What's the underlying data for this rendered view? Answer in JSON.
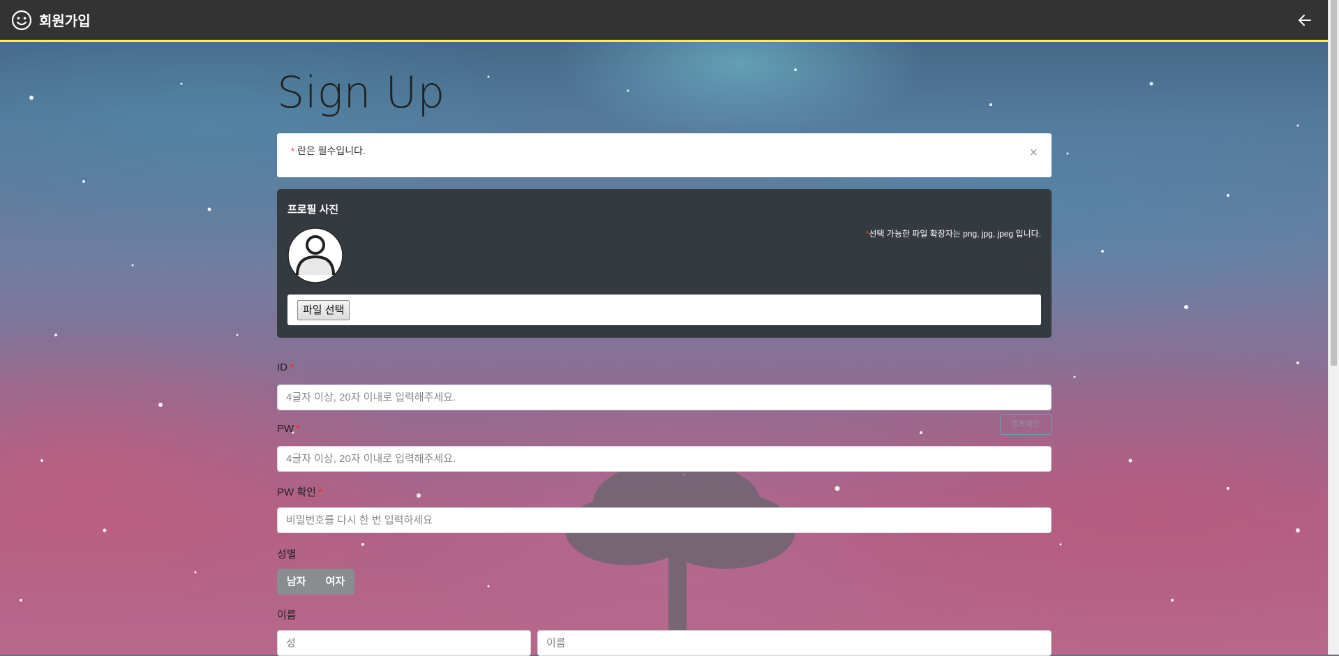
{
  "header": {
    "app_icon": "smile-icon",
    "title": "회원가입",
    "back_icon": "arrow-left-icon"
  },
  "page": {
    "title": "Sign Up"
  },
  "notice": {
    "required_mark": "*",
    "text": " 란은 필수입니다.",
    "close_label": "×"
  },
  "profile": {
    "title": "프로필 사진",
    "hint_mark": "*",
    "hint": "선택 가능한 파일 확장자는 png, jpg, jpeg 입니다.",
    "avatar_icon": "user-avatar-icon",
    "file_button_label": "파일 선택"
  },
  "form": {
    "id": {
      "label": "ID",
      "required_mark": "*",
      "placeholder": "4글자 이상, 20자 이내로 입력해주세요."
    },
    "pw": {
      "label": "PW",
      "required_mark": "*",
      "placeholder": "4글자 이상, 20자 이내로 입력해주세요."
    },
    "pw_confirm": {
      "label": "PW 확인",
      "required_mark": "*",
      "placeholder": "비밀번호를 다시 한 번 입력하세요"
    },
    "duplicate_check_label": "중복확인",
    "gender": {
      "label": "성별",
      "options": [
        "남자",
        "여자"
      ]
    },
    "name": {
      "label": "이름",
      "last_placeholder": "성",
      "first_placeholder": "이름"
    }
  },
  "colors": {
    "header_bg": "#333333",
    "header_accent": "#f2f53a",
    "required": "#e53935",
    "panel_bg": "#343a40"
  }
}
